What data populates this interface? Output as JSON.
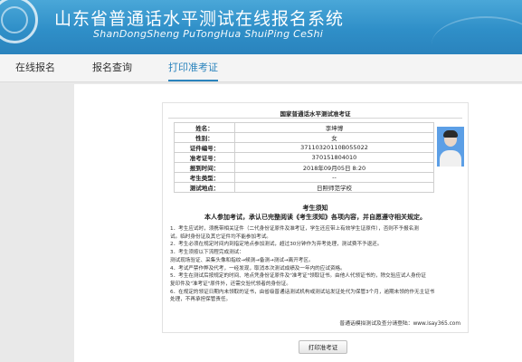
{
  "header": {
    "title_cn": "山东省普通话水平测试在线报名系统",
    "title_en": "ShanDongSheng PuTongHua ShuiPing CeShi"
  },
  "nav": {
    "tabs": [
      {
        "label": "在线报名"
      },
      {
        "label": "报名查询"
      },
      {
        "label": "打印准考证"
      }
    ]
  },
  "ticket": {
    "title": "国家普通话水平测试准考证",
    "rows": [
      {
        "label": "姓名：",
        "value": "李坤博"
      },
      {
        "label": "性别：",
        "value": "女"
      },
      {
        "label": "证件编号：",
        "value": "37110320110B055022"
      },
      {
        "label": "准考证号：",
        "value": "370151804010"
      },
      {
        "label": "报到时间：",
        "value": "2018年09月05日 8:20"
      },
      {
        "label": "考生类型：",
        "value": "--"
      },
      {
        "label": "测试地点：",
        "value": "日照师范学校"
      }
    ],
    "notice_title": "考生须知",
    "notice_subtitle": "本人参加考试，承认已完整阅读《考生须知》各项内容，并自愿遵守相关规定。",
    "rules": [
      "1．考生应试时，须携带相关证件（二代身份证原件及准考证，学生还应带上有效学生证原件），否则不予报名测",
      "试。临时身份证及其它证件均不能参加考试。",
      "2．考生必须在规定时间内到指定地点参加测试，超过30分钟作为弃考处理，测试费不予退还。",
      "3．考生须按以下流程完成测试：",
      "测试现场验证、采集头像和指纹→候测→备测→测试→离开考区。",
      "4．考试严禁作弊及代考，一经发现，取消本次测试成绩及一年内的应试资格。",
      "5．考生在测试后按规定的时间、地点凭身份证原件及\"准考证\"领取证书。由他人代领证书的，除交验应试人身份证",
      "复印件及\"准考证\"原件外，还需交验代领者的身份证。",
      "6．在规定的领证日期内未领取的证书，由省级普通话测试机构或测试站发证处代为保管3个月，逾期未领的作无主证书",
      "处理，不再承担保管责任。"
    ],
    "footer_note": "普通话模拟测试及查分请登陆：www.isay365.com"
  },
  "actions": {
    "print_label": "打印准考证"
  },
  "colors": {
    "header_blue": "#2f8fc8",
    "active_tab": "#2a83bd",
    "photo_bg": "#5c9fe6"
  }
}
